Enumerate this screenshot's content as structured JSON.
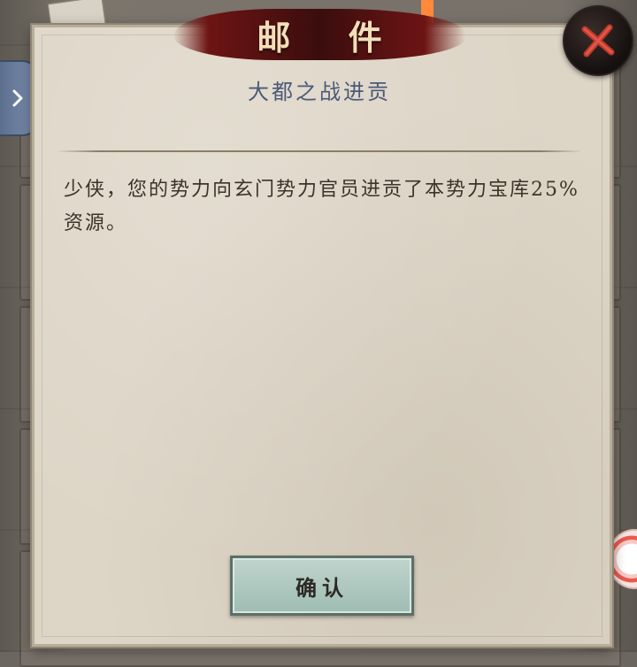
{
  "dialog": {
    "title": "邮 件",
    "subject": "大都之战进贡",
    "body": "少侠，您的势力向玄门势力官员进贡了本势力宝库25%资源。",
    "confirm_label": "确认"
  },
  "colors": {
    "banner": "#3a0d0d",
    "subject": "#4b5a78",
    "paper": "#ddd5c6",
    "confirm_button": "#9fbdb3",
    "close_x": "#c0392b"
  }
}
